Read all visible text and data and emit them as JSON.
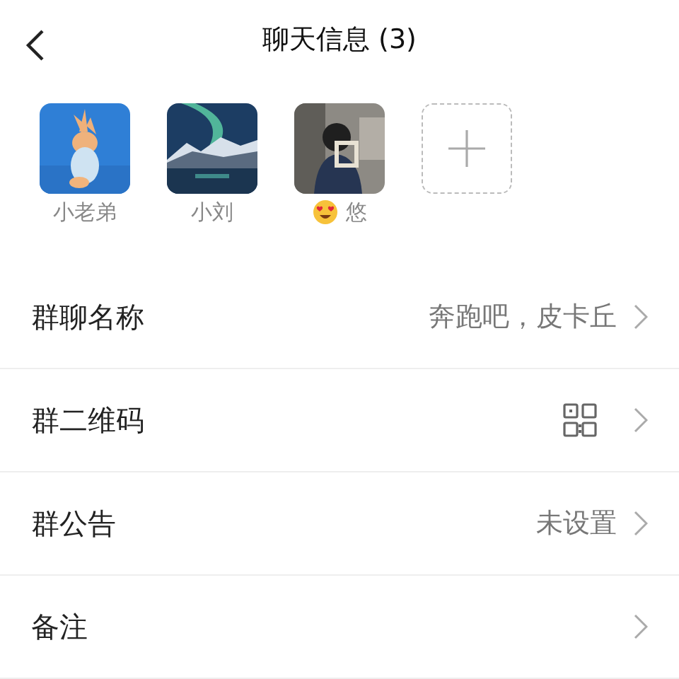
{
  "header": {
    "title": "聊天信息 (3)"
  },
  "members": [
    {
      "name": "小老弟",
      "emoji": false
    },
    {
      "name": "小刘",
      "emoji": false
    },
    {
      "name": "悠",
      "emoji": true
    }
  ],
  "rows": [
    {
      "kind": "text",
      "label": "群聊名称",
      "value": "奔跑吧，皮卡丘"
    },
    {
      "kind": "qr",
      "label": "群二维码"
    },
    {
      "kind": "text",
      "label": "群公告",
      "value": "未设置"
    },
    {
      "kind": "text",
      "label": "备注"
    }
  ]
}
